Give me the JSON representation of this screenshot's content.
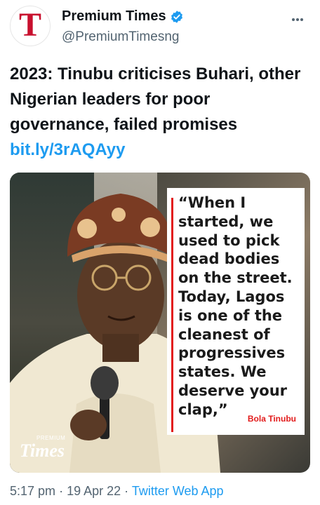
{
  "author": {
    "display_name": "Premium Times",
    "handle": "@PremiumTimesng",
    "avatar_letter": "T",
    "verified": true
  },
  "tweet": {
    "headline": "2023: Tinubu criticises Buhari, other Nigerian leaders for poor governance, failed promises",
    "link": "bit.ly/3rAQAyy"
  },
  "image_card": {
    "quote": "“When I started, we used to pick dead bodies on the street. Today, Lagos is one of the cleanest of progressives states. We deserve your clap,”",
    "quote_author": "Bola Tinubu",
    "watermark_small": "PREMIUM",
    "watermark_big": "Times"
  },
  "meta": {
    "time": "5:17 pm",
    "separator": "·",
    "date": "19 Apr 22",
    "source": "Twitter Web App"
  },
  "colors": {
    "brand_red": "#c8102e",
    "link_blue": "#1d9bf0",
    "quote_bar": "#e21b1b"
  },
  "icons": {
    "verified": "verified-badge-icon",
    "more": "more-options-icon"
  }
}
